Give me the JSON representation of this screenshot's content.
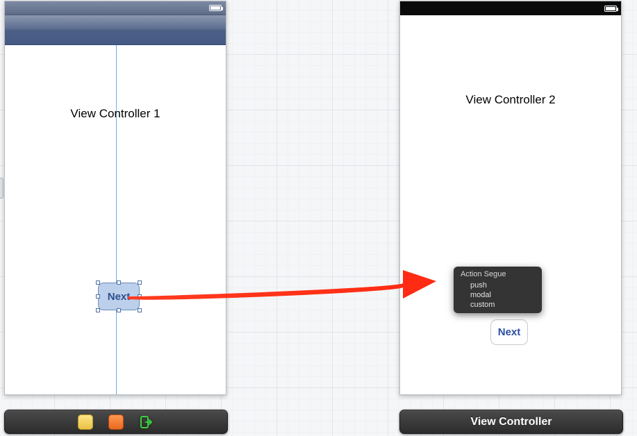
{
  "phone1": {
    "title": "View Controller 1",
    "next_label": "Next"
  },
  "phone2": {
    "title": "View Controller 2",
    "next_label": "Next"
  },
  "hud": {
    "title": "Action Segue",
    "items": [
      "push",
      "modal",
      "custom"
    ]
  },
  "dock2_title": "View Controller"
}
